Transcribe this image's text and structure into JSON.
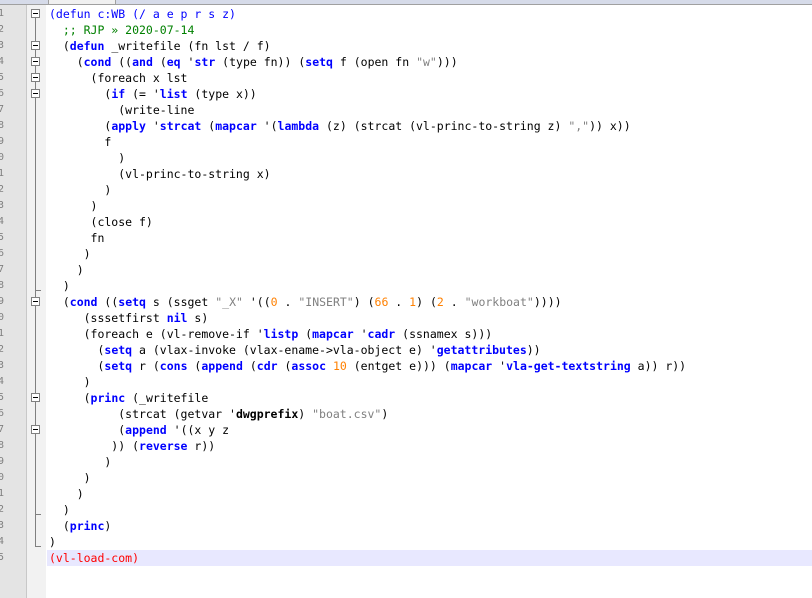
{
  "editor": {
    "line_numbers": [
      "1",
      "2",
      "3",
      "4",
      "5",
      "6",
      "7",
      "8",
      "9",
      "0",
      "1",
      "2",
      "3",
      "4",
      "5",
      "6",
      "7",
      "8",
      "9",
      "0",
      "1",
      "2",
      "3",
      "4",
      "5",
      "6",
      "7",
      "8",
      "9",
      "0",
      "1",
      "2",
      "3",
      "4",
      "5"
    ],
    "lines": [
      [
        [
          "p",
          "(defun c:WB (/ a e p r s z)"
        ]
      ],
      [
        [
          "c",
          "  ;; RJP » 2020-07-14"
        ]
      ],
      [
        [
          "p",
          "  ("
        ],
        [
          "k",
          "defun"
        ],
        [
          "p",
          " _writefile (fn lst / f)"
        ]
      ],
      [
        [
          "p",
          "    ("
        ],
        [
          "k",
          "cond"
        ],
        [
          "p",
          " (("
        ],
        [
          "k",
          "and"
        ],
        [
          "p",
          " ("
        ],
        [
          "k",
          "eq"
        ],
        [
          "p",
          " '"
        ],
        [
          "k",
          "str"
        ],
        [
          "p",
          " (type fn)) ("
        ],
        [
          "k",
          "setq"
        ],
        [
          "p",
          " f (open fn "
        ],
        [
          "s",
          "\"w\""
        ],
        [
          "p",
          ")))"
        ]
      ],
      [
        [
          "p",
          "      (foreach x lst"
        ]
      ],
      [
        [
          "p",
          "        ("
        ],
        [
          "k",
          "if"
        ],
        [
          "p",
          " (= '"
        ],
        [
          "k",
          "list"
        ],
        [
          "p",
          " (type x))"
        ]
      ],
      [
        [
          "p",
          "          (write-line"
        ]
      ],
      [
        [
          "p",
          "        ("
        ],
        [
          "k",
          "apply"
        ],
        [
          "p",
          " '"
        ],
        [
          "k",
          "strcat"
        ],
        [
          "p",
          " ("
        ],
        [
          "k",
          "mapcar"
        ],
        [
          "p",
          " '("
        ],
        [
          "k",
          "lambda"
        ],
        [
          "p",
          " (z) (strcat (vl-princ-to-string z) "
        ],
        [
          "s",
          "\",\""
        ],
        [
          "p",
          ")) x))"
        ]
      ],
      [
        [
          "p",
          "        f"
        ]
      ],
      [
        [
          "p",
          "          )"
        ]
      ],
      [
        [
          "p",
          "          (vl-princ-to-string x)"
        ]
      ],
      [
        [
          "p",
          "        )"
        ]
      ],
      [
        [
          "p",
          "      )"
        ]
      ],
      [
        [
          "p",
          "      (close f)"
        ]
      ],
      [
        [
          "p",
          "      fn"
        ]
      ],
      [
        [
          "p",
          "     )"
        ]
      ],
      [
        [
          "p",
          "    )"
        ]
      ],
      [
        [
          "p",
          "  )"
        ]
      ],
      [
        [
          "p",
          "  ("
        ],
        [
          "k",
          "cond"
        ],
        [
          "p",
          " (("
        ],
        [
          "k",
          "setq"
        ],
        [
          "p",
          " s (ssget "
        ],
        [
          "s",
          "\"_X\""
        ],
        [
          "p",
          " '(("
        ],
        [
          "n",
          "0"
        ],
        [
          "p",
          " . "
        ],
        [
          "s",
          "\"INSERT\""
        ],
        [
          "p",
          ") ("
        ],
        [
          "n",
          "66"
        ],
        [
          "p",
          " . "
        ],
        [
          "n",
          "1"
        ],
        [
          "p",
          ") ("
        ],
        [
          "n",
          "2"
        ],
        [
          "p",
          " . "
        ],
        [
          "s",
          "\"workboat\""
        ],
        [
          "p",
          "))))"
        ]
      ],
      [
        [
          "p",
          "     (sssetfirst "
        ],
        [
          "k",
          "nil"
        ],
        [
          "p",
          " s)"
        ]
      ],
      [
        [
          "p",
          "     (foreach e (vl-remove-if '"
        ],
        [
          "k",
          "listp"
        ],
        [
          "p",
          " ("
        ],
        [
          "k",
          "mapcar"
        ],
        [
          "p",
          " '"
        ],
        [
          "k",
          "cadr"
        ],
        [
          "p",
          " (ssnamex s)))"
        ]
      ],
      [
        [
          "p",
          "       ("
        ],
        [
          "k",
          "setq"
        ],
        [
          "p",
          " a (vlax-invoke (vlax-ename->vla-object e) '"
        ],
        [
          "k",
          "getattributes"
        ],
        [
          "p",
          "))"
        ]
      ],
      [
        [
          "p",
          "       ("
        ],
        [
          "k",
          "setq"
        ],
        [
          "p",
          " r ("
        ],
        [
          "k",
          "cons"
        ],
        [
          "p",
          " ("
        ],
        [
          "k",
          "append"
        ],
        [
          "p",
          " ("
        ],
        [
          "k",
          "cdr"
        ],
        [
          "p",
          " ("
        ],
        [
          "k",
          "assoc"
        ],
        [
          "p",
          " "
        ],
        [
          "n",
          "10"
        ],
        [
          "p",
          " (entget e))) ("
        ],
        [
          "k",
          "mapcar"
        ],
        [
          "p",
          " '"
        ],
        [
          "k",
          "vla-get-textstring"
        ],
        [
          "p",
          " a)) r))"
        ]
      ],
      [
        [
          "p",
          "     )"
        ]
      ],
      [
        [
          "p",
          "     ("
        ],
        [
          "k",
          "princ"
        ],
        [
          "p",
          " (_writefile"
        ]
      ],
      [
        [
          "p",
          "          (strcat (getvar '"
        ],
        [
          "h",
          "dwgprefix"
        ],
        [
          "p",
          ") "
        ],
        [
          "s",
          "\"boat.csv\""
        ],
        [
          "p",
          ")"
        ]
      ],
      [
        [
          "p",
          "          ("
        ],
        [
          "k",
          "append"
        ],
        [
          "p",
          " '((x y z"
        ]
      ],
      [
        [
          "p",
          "         )) ("
        ],
        [
          "k",
          "reverse"
        ],
        [
          "p",
          " r))"
        ]
      ],
      [
        [
          "p",
          "        )"
        ]
      ],
      [
        [
          "p",
          "     )"
        ]
      ],
      [
        [
          "p",
          "    )"
        ]
      ],
      [
        [
          "p",
          "  )"
        ]
      ],
      [
        [
          "p",
          "  ("
        ],
        [
          "k",
          "princ"
        ],
        [
          "p",
          ")"
        ]
      ],
      [
        [
          "p",
          ")"
        ]
      ],
      [
        [
          "r",
          "(vl-load-com)"
        ]
      ]
    ]
  }
}
